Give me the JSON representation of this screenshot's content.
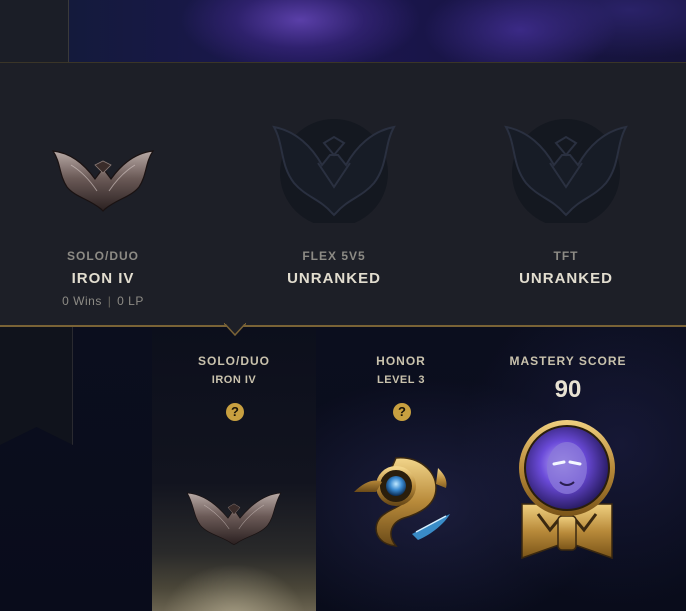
{
  "ranked_panel": {
    "queues": [
      {
        "queue": "SOLO/DUO",
        "tier": "IRON IV",
        "wins": "0 Wins",
        "lp": "0 LP",
        "emblem": "iron-emblem-icon"
      },
      {
        "queue": "FLEX 5V5",
        "tier": "UNRANKED",
        "emblem": "unranked-emblem-icon"
      },
      {
        "queue": "TFT",
        "tier": "UNRANKED",
        "emblem": "unranked-emblem-icon"
      }
    ],
    "stats_separator": "|"
  },
  "summary": {
    "solo": {
      "title": "SOLO/DUO",
      "sub": "IRON IV",
      "help": "?"
    },
    "honor": {
      "title": "HONOR",
      "sub": "LEVEL 3",
      "help": "?"
    },
    "mastery": {
      "title": "MASTERY SCORE",
      "score": "90"
    }
  },
  "colors": {
    "gold_accent": "#c8a040",
    "panel_bg": "#1d1f27",
    "text_primary": "#e2ddcf",
    "text_secondary": "#8d8b85"
  }
}
